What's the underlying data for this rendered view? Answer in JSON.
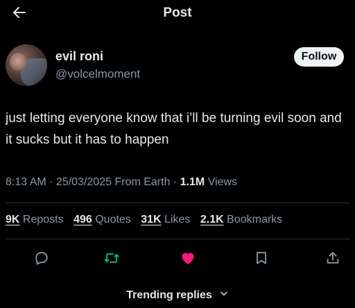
{
  "header": {
    "title": "Post",
    "back_icon": "arrow-left-icon"
  },
  "author": {
    "display_name": "evil roni",
    "handle": "@volcelmoment",
    "follow_label": "Follow"
  },
  "tweet": {
    "text": "just letting everyone know that i’ll be turning evil soon and it sucks but it has to happen"
  },
  "meta": {
    "time": "8:13 AM",
    "separator": " · ",
    "date": "25/03/2025",
    "source": "From Earth",
    "views_count": "1.1M",
    "views_label": "Views"
  },
  "stats": {
    "reposts": {
      "count": "9K",
      "label": "Reposts"
    },
    "quotes": {
      "count": "496",
      "label": "Quotes"
    },
    "likes": {
      "count": "31K",
      "label": "Likes"
    },
    "bookmarks": {
      "count": "2.1K",
      "label": "Bookmarks"
    }
  },
  "actions": {
    "reply_icon": "reply-icon",
    "repost_icon": "repost-icon",
    "like_icon": "heart-icon",
    "bookmark_icon": "bookmark-icon",
    "share_icon": "share-icon",
    "repost_color": "#00ba7c",
    "like_color": "#f91880"
  },
  "footer": {
    "trending_label": "Trending replies"
  },
  "colors": {
    "background": "#000000",
    "text": "#e7e9ea",
    "secondary": "#8b98a5",
    "divider": "#2f3336"
  }
}
